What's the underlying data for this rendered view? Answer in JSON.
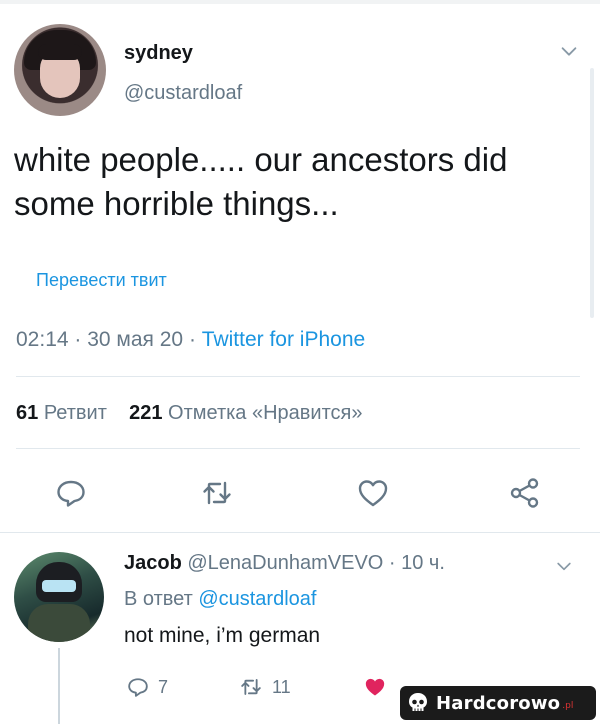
{
  "tweet": {
    "display_name": "sydney",
    "handle": "@custardloaf",
    "text_line1": "white people..... our ancestors did",
    "text_line2": "some horrible things...",
    "translate_label": "Перевести твит",
    "time": "02:14",
    "date": "30 мая 20",
    "separator": " · ",
    "source": "Twitter for iPhone",
    "retweet_count": "61",
    "retweet_label": "Ретвит",
    "like_count": "221",
    "like_label": "Отметка «Нравится»"
  },
  "reply": {
    "display_name": "Jacob",
    "handle": "@LenaDunhamVEVO",
    "time_ago": "10 ч.",
    "in_reply_prefix": "В ответ",
    "in_reply_to": "@custardloaf",
    "text": "not mine, i’m german",
    "reply_count": "7",
    "retweet_count": "11"
  },
  "watermark": {
    "text": "Hardcorowo",
    "tld": ".pl"
  },
  "icons": {
    "header_chevron": "chevron-down-icon",
    "reply": "reply-icon",
    "retweet": "retweet-icon",
    "like": "heart-icon",
    "share": "share-icon",
    "watermark_logo": "skull-icon"
  },
  "colors": {
    "link_blue": "#1b95e0",
    "secondary_text": "#657786",
    "liked_red": "#e0245e"
  }
}
